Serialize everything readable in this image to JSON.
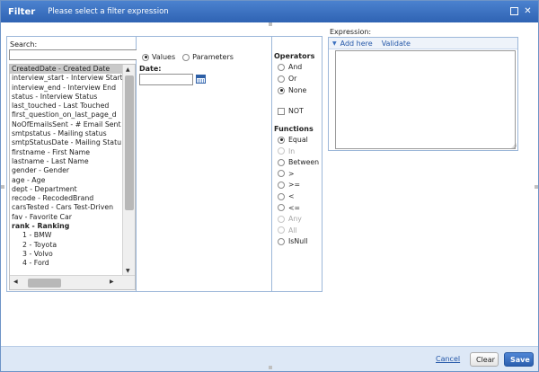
{
  "dialog": {
    "title": "Filter",
    "subtitle": "Please select a filter expression"
  },
  "search": {
    "label": "Search:",
    "value": "",
    "placeholder": ""
  },
  "fields": [
    {
      "label": "CreatedDate - Created Date",
      "selected": true
    },
    {
      "label": "interview_start - Interview Start"
    },
    {
      "label": "interview_end - Interview End"
    },
    {
      "label": "status - Interview Status"
    },
    {
      "label": "last_touched - Last Touched"
    },
    {
      "label": "first_question_on_last_page_d"
    },
    {
      "label": "NoOfEmailsSent - # Email Sent"
    },
    {
      "label": "smtpstatus - Mailing status"
    },
    {
      "label": "smtpStatusDate - Mailing Statu"
    },
    {
      "label": "firstname - First Name"
    },
    {
      "label": "lastname - Last Name"
    },
    {
      "label": "gender - Gender"
    },
    {
      "label": "age - Age"
    },
    {
      "label": "dept - Department"
    },
    {
      "label": "recode - RecodedBrand"
    },
    {
      "label": "carsTested - Cars Test-Driven"
    },
    {
      "label": "fav - Favorite Car"
    },
    {
      "label": "rank - Ranking",
      "bold": true
    },
    {
      "label": "1 - BMW",
      "child": true
    },
    {
      "label": "2 - Toyota",
      "child": true
    },
    {
      "label": "3 - Volvo",
      "child": true
    },
    {
      "label": "4 - Ford",
      "child": true
    }
  ],
  "value_mode": {
    "values_label": "Values",
    "parameters_label": "Parameters",
    "selected": "values"
  },
  "date": {
    "label": "Date:",
    "value": ""
  },
  "operators": {
    "title": "Operators",
    "items": [
      {
        "label": "And",
        "selected": false
      },
      {
        "label": "Or",
        "selected": false
      },
      {
        "label": "None",
        "selected": true
      }
    ],
    "not_label": "NOT"
  },
  "functions": {
    "title": "Functions",
    "items": [
      {
        "label": "Equal",
        "selected": true,
        "disabled": false
      },
      {
        "label": "In",
        "selected": false,
        "disabled": true
      },
      {
        "label": "Between",
        "selected": false,
        "disabled": false
      },
      {
        "label": ">",
        "selected": false,
        "disabled": false
      },
      {
        "label": ">=",
        "selected": false,
        "disabled": false
      },
      {
        "label": "<",
        "selected": false,
        "disabled": false
      },
      {
        "label": "<=",
        "selected": false,
        "disabled": false
      },
      {
        "label": "Any",
        "selected": false,
        "disabled": true
      },
      {
        "label": "All",
        "selected": false,
        "disabled": true
      },
      {
        "label": "IsNull",
        "selected": false,
        "disabled": false
      }
    ]
  },
  "expression": {
    "label": "Expression:",
    "add_here": "Add here",
    "validate": "Validate",
    "value": ""
  },
  "footer": {
    "cancel": "Cancel",
    "clear": "Clear",
    "save": "Save"
  },
  "colors": {
    "titlebar": "#2f63b3",
    "link": "#2457a8",
    "save_button": "#2c5fae",
    "footer_bg": "#dde8f6"
  }
}
